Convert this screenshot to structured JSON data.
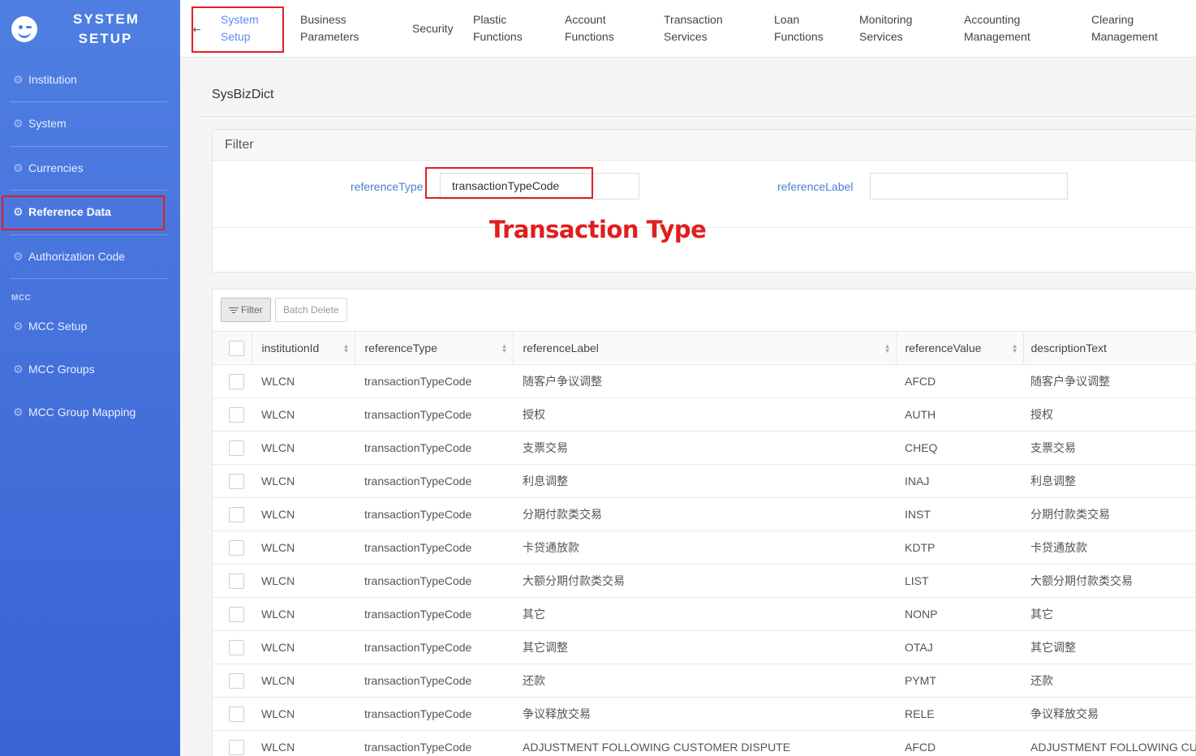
{
  "sidebar": {
    "brand": "SYSTEM SETUP",
    "items": [
      {
        "label": "Institution"
      },
      {
        "label": "System"
      },
      {
        "label": "Currencies"
      },
      {
        "label": "Reference Data",
        "active": true
      },
      {
        "label": "Authorization Code"
      }
    ],
    "section_label": "MCC",
    "mcc_items": [
      {
        "label": "MCC Setup"
      },
      {
        "label": "MCC Groups"
      },
      {
        "label": "MCC Group Mapping"
      }
    ]
  },
  "topnav": {
    "tabs": [
      {
        "line1": "System",
        "line2": "Setup",
        "active": true
      },
      {
        "line1": "Business",
        "line2": "Parameters"
      },
      {
        "line1": "Security",
        "line2": ""
      },
      {
        "line1": "Plastic",
        "line2": "Functions"
      },
      {
        "line1": "Account",
        "line2": "Functions"
      },
      {
        "line1": "Transaction",
        "line2": "Services"
      },
      {
        "line1": "Loan",
        "line2": "Functions"
      },
      {
        "line1": "Monitoring",
        "line2": "Services"
      },
      {
        "line1": "Accounting",
        "line2": "Management"
      },
      {
        "line1": "Clearing",
        "line2": "Management"
      }
    ]
  },
  "page": {
    "title": "SysBizDict"
  },
  "filter": {
    "heading": "Filter",
    "reference_type_label": "referenceType",
    "reference_type_value": "transactionTypeCode",
    "reference_label_label": "referenceLabel",
    "reference_label_value": "",
    "annotation": "Transaction Type"
  },
  "toolbar": {
    "filter_label": "Filter",
    "batch_delete_label": "Batch Delete"
  },
  "table": {
    "columns": [
      "institutionId",
      "referenceType",
      "referenceLabel",
      "referenceValue",
      "descriptionText"
    ],
    "rows": [
      [
        "WLCN",
        "transactionTypeCode",
        "随客户争议调整",
        "AFCD",
        "随客户争议调整"
      ],
      [
        "WLCN",
        "transactionTypeCode",
        "授权",
        "AUTH",
        "授权"
      ],
      [
        "WLCN",
        "transactionTypeCode",
        "支票交易",
        "CHEQ",
        "支票交易"
      ],
      [
        "WLCN",
        "transactionTypeCode",
        "利息调整",
        "INAJ",
        "利息调整"
      ],
      [
        "WLCN",
        "transactionTypeCode",
        "分期付款类交易",
        "INST",
        "分期付款类交易"
      ],
      [
        "WLCN",
        "transactionTypeCode",
        "卡贷通放款",
        "KDTP",
        "卡贷通放款"
      ],
      [
        "WLCN",
        "transactionTypeCode",
        "大额分期付款类交易",
        "LIST",
        "大额分期付款类交易"
      ],
      [
        "WLCN",
        "transactionTypeCode",
        "其它",
        "NONP",
        "其它"
      ],
      [
        "WLCN",
        "transactionTypeCode",
        "其它调整",
        "OTAJ",
        "其它调整"
      ],
      [
        "WLCN",
        "transactionTypeCode",
        "还款",
        "PYMT",
        "还款"
      ],
      [
        "WLCN",
        "transactionTypeCode",
        "争议释放交易",
        "RELE",
        "争议释放交易"
      ],
      [
        "WLCN",
        "transactionTypeCode",
        "ADJUSTMENT FOLLOWING CUSTOMER DISPUTE",
        "AFCD",
        "ADJUSTMENT FOLLOWING CUSTOMER DISPUTE"
      ]
    ]
  },
  "colors": {
    "sidebar_top": "#4f7fe2",
    "sidebar_bottom": "#3a62d3",
    "accent": "#5a8ef0",
    "highlight": "#e02020"
  }
}
